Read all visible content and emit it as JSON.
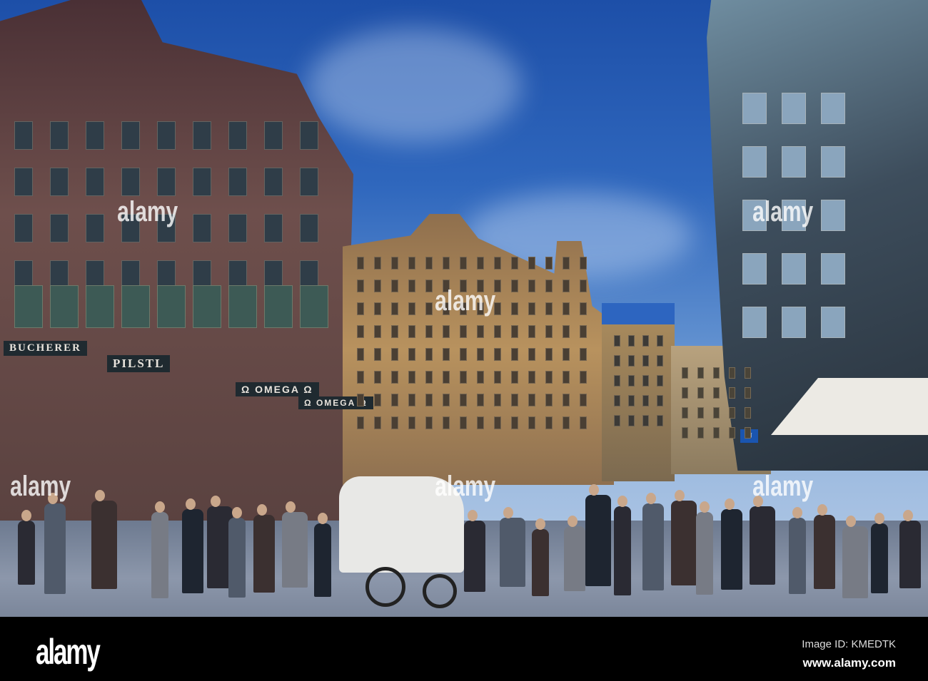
{
  "photo": {
    "signs": {
      "bucherer": "BUCHERER",
      "pilstl": "PILSTL",
      "omega_1": "Ω OMEGA Ω",
      "omega_2": "Ω OMEGA Ω",
      "metro": "U"
    },
    "watermark": "alamy"
  },
  "footer": {
    "logo": "alamy",
    "image_id": "Image ID: KMEDTK",
    "website": "www.alamy.com"
  },
  "colors": {
    "sky": "#2f67bd",
    "left_building": "#5a3e3e",
    "center_building": "#b08a5a",
    "glass_building": "#3d4d5c",
    "ground": "#7b869a"
  }
}
